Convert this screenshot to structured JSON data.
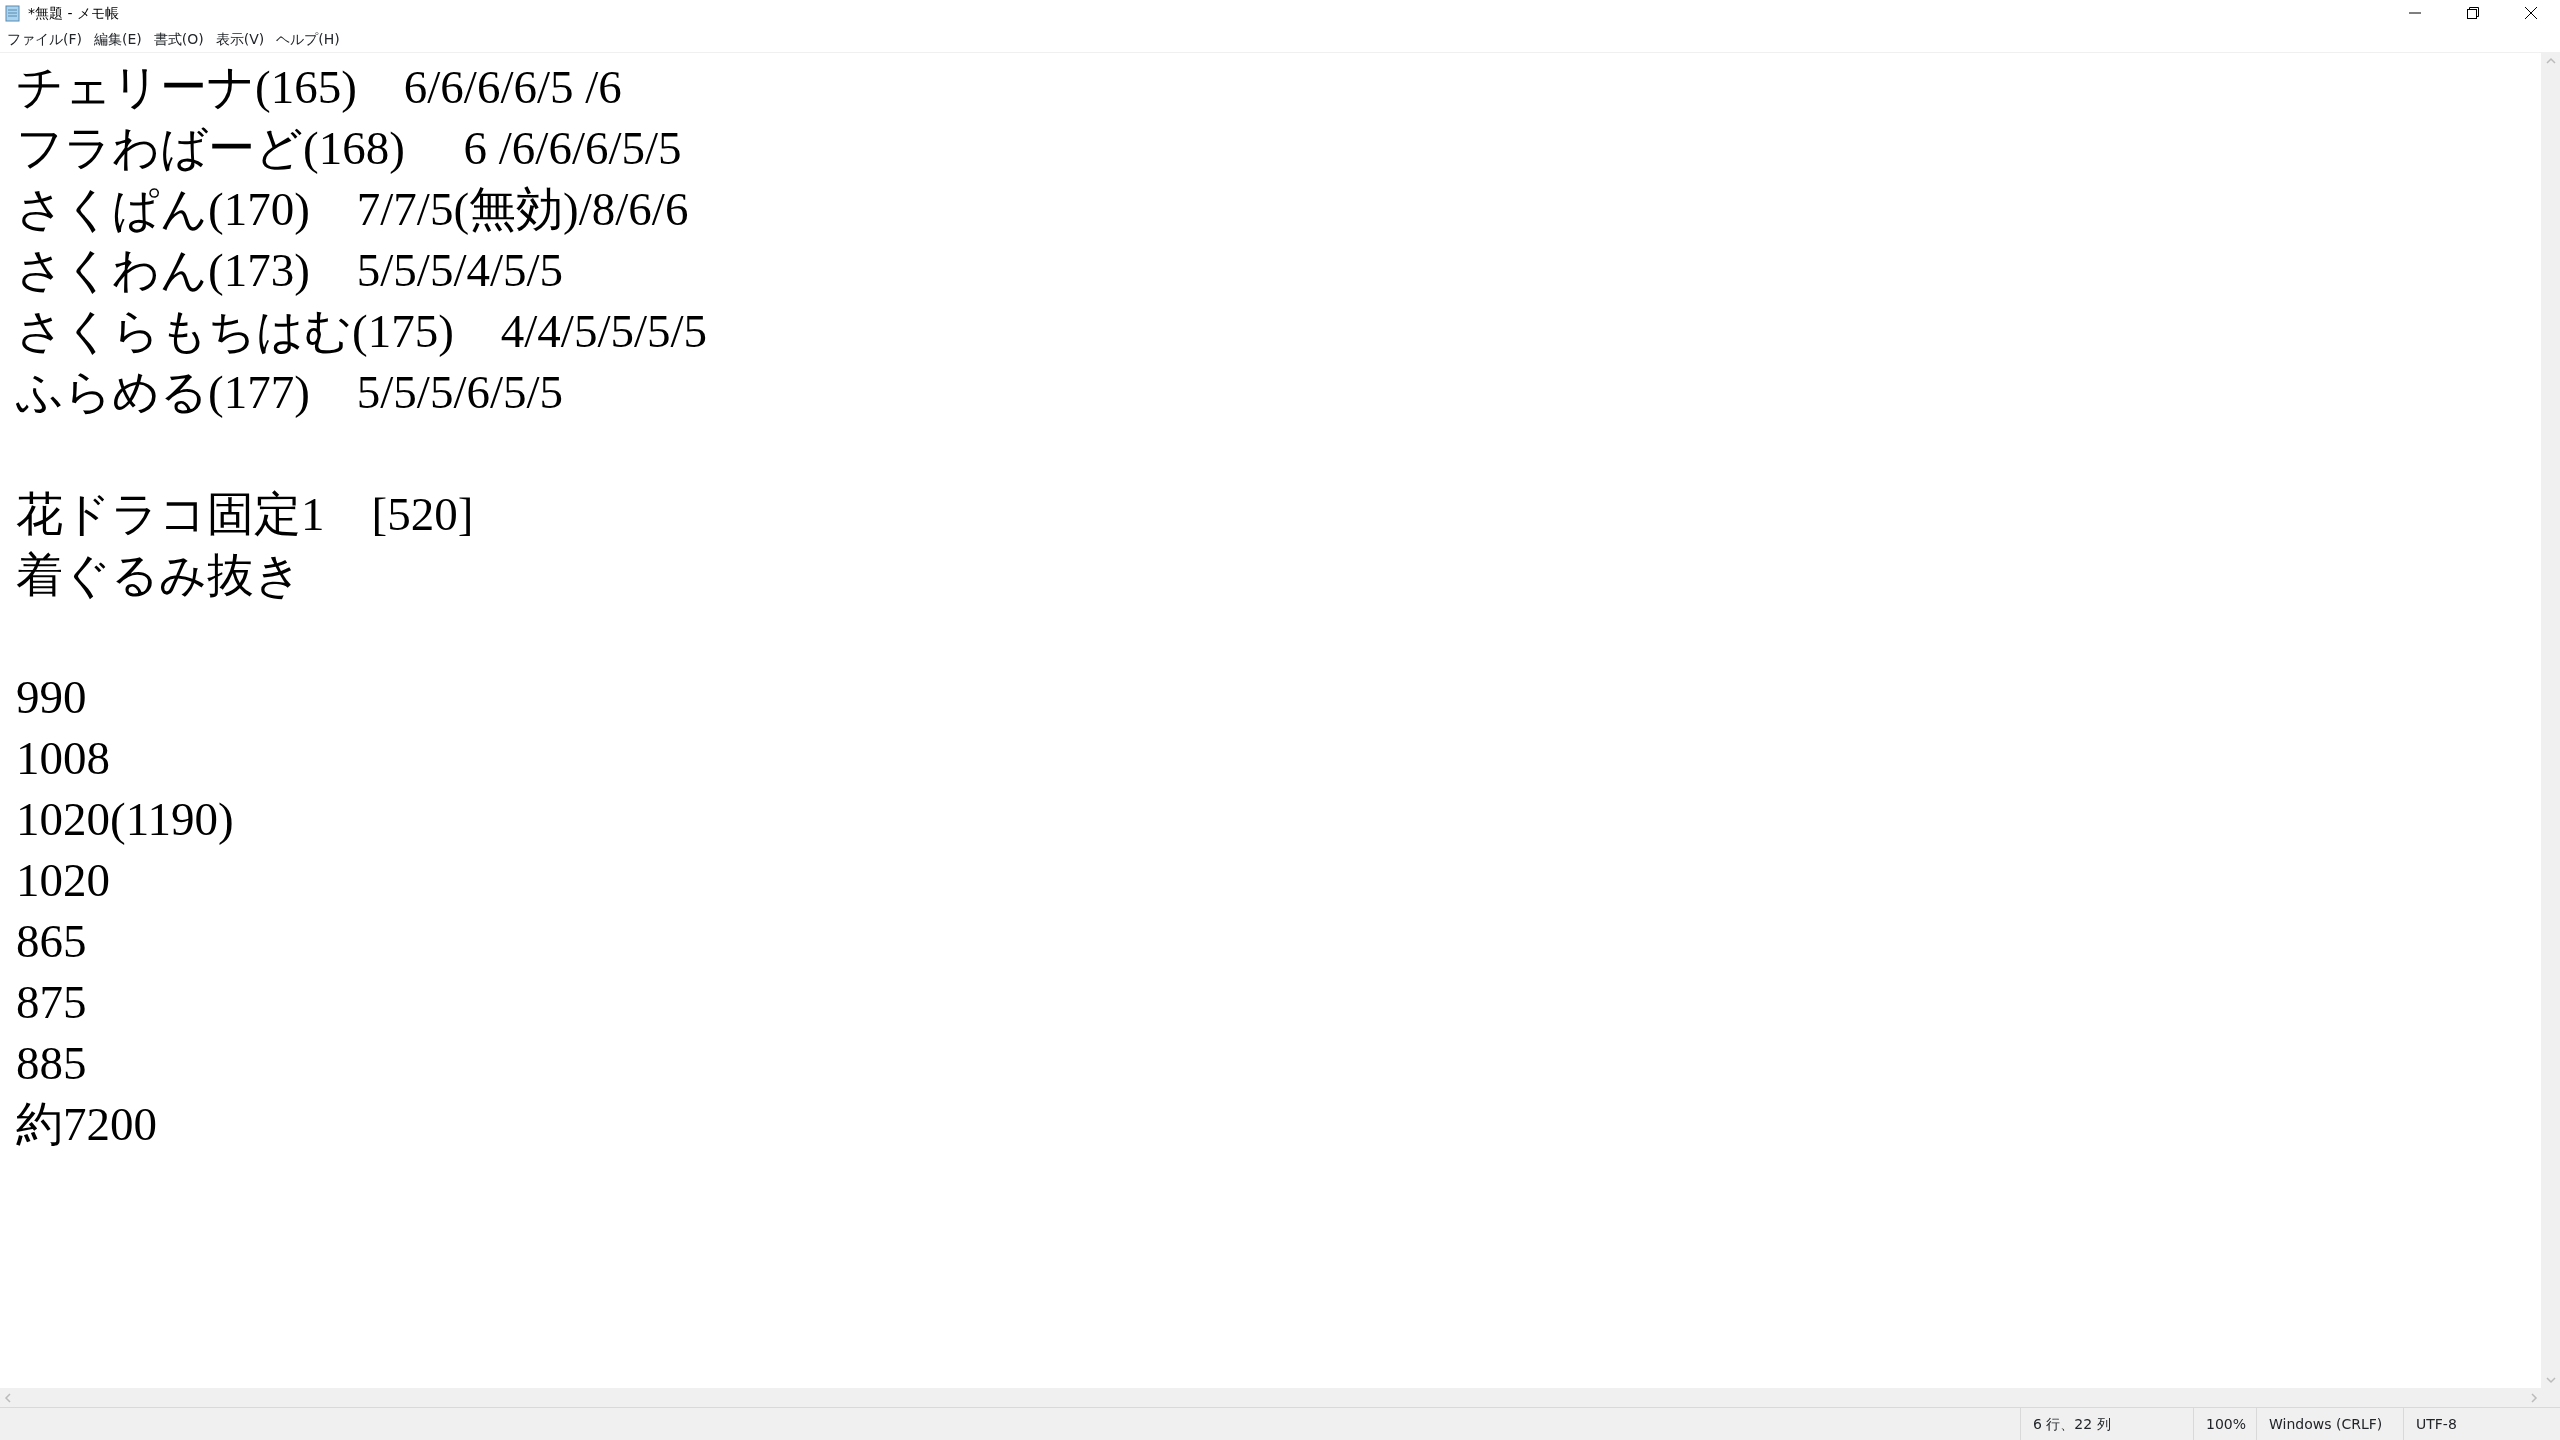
{
  "window": {
    "title": "*無題 - メモ帳"
  },
  "menu": [
    "ファイル(F)",
    "編集(E)",
    "書式(O)",
    "表示(V)",
    "ヘルプ(H)"
  ],
  "text_blocks": [
    {
      "lines": [
        "チェリーナ(165)　6/6/6/6/5 /6",
        "フラわばーど(168)　 6 /6/6/6/5/5",
        "さくぱん(170)　7/7/5(無効)/8/6/6",
        "さくわん(173)　5/5/5/4/5/5",
        "さくらもちはむ(175)　4/4/5/5/5/5",
        "ふらめる(177)　5/5/5/6/5/5"
      ]
    },
    {
      "lines": [
        "花ドラコ固定1　[520]",
        "着ぐるみ抜き"
      ]
    },
    {
      "lines": [
        "990",
        "1008",
        "1020(1190)",
        "1020",
        "865",
        "875",
        "885",
        "約7200"
      ]
    }
  ],
  "status_bar": [
    "6 行、22 列",
    "100%",
    "Windows (CRLF)",
    "UTF-8"
  ]
}
